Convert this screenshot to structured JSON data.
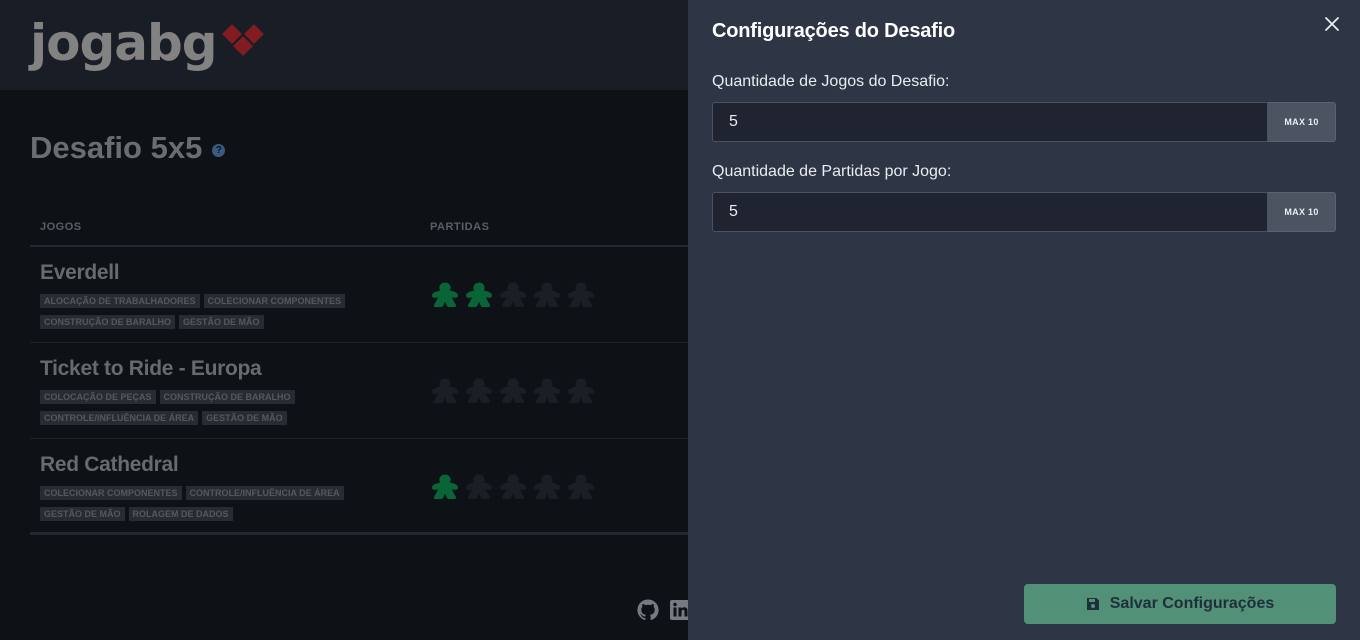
{
  "brand": {
    "logo_text": "jogabg",
    "accent": "#8b1e22"
  },
  "page": {
    "title": "Desafio 5x5",
    "help_icon": "question-circle-icon"
  },
  "table": {
    "headers": {
      "games": "JOGOS",
      "matches": "PARTIDAS"
    },
    "rows": [
      {
        "name": "Everdell",
        "tags": [
          "ALOCAÇÃO DE TRABALHADORES",
          "COLECIONAR COMPONENTES",
          "CONSTRUÇÃO DE BARALHO",
          "GESTÃO DE MÃO"
        ],
        "completed": 2,
        "total": 5
      },
      {
        "name": "Ticket to Ride - Europa",
        "tags": [
          "COLOCAÇÃO DE PEÇAS",
          "CONSTRUÇÃO DE BARALHO",
          "CONTROLE/INFLUÊNCIA DE ÁREA",
          "GESTÃO DE MÃO"
        ],
        "completed": 0,
        "total": 5
      },
      {
        "name": "Red Cathedral",
        "tags": [
          "COLECIONAR COMPONENTES",
          "CONTROLE/INFLUÊNCIA DE ÁREA",
          "GESTÃO DE MÃO",
          "ROLAGEM DE DADOS"
        ],
        "completed": 1,
        "total": 5
      }
    ],
    "meeple_color_done": "#0a6b3a",
    "meeple_color_pending": "#1d2128"
  },
  "footer": {
    "icons": [
      "github-icon",
      "linkedin-icon"
    ]
  },
  "drawer": {
    "title": "Configurações do Desafio",
    "fields": [
      {
        "label": "Quantidade de Jogos do Desafio:",
        "value": "5",
        "addon": "MAX 10"
      },
      {
        "label": "Quantidade de Partidas por Jogo:",
        "value": "5",
        "addon": "MAX 10"
      }
    ],
    "save_label": "Salvar Configurações",
    "save_color": "#529078"
  }
}
